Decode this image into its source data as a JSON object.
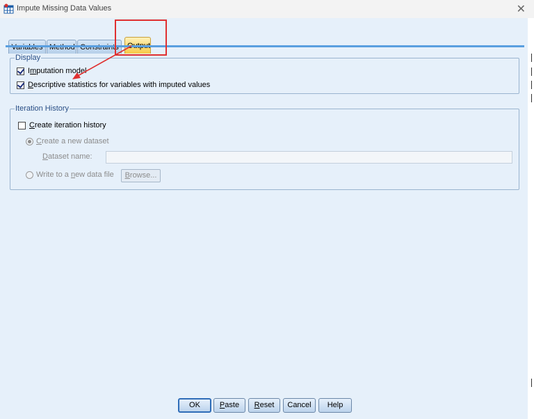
{
  "window": {
    "title": "Impute Missing Data Values",
    "icon": "dataset-table-icon",
    "close_glyph": "✕"
  },
  "tabs": [
    {
      "label": "Variables",
      "active": false
    },
    {
      "label": "Method",
      "active": false
    },
    {
      "label": "Constraints",
      "active": false
    },
    {
      "label": "Output",
      "active": true
    }
  ],
  "display": {
    "legend": "Display",
    "imputation_model": {
      "pre": "I",
      "key": "m",
      "post": "putation model",
      "checked": true
    },
    "descriptive_stats": {
      "pre": "",
      "key": "D",
      "post": "escriptive statistics for variables with imputed values",
      "checked": true
    }
  },
  "iteration": {
    "legend": "Iteration History",
    "create_history": {
      "pre": "",
      "key": "C",
      "post": "reate iteration history",
      "checked": false
    },
    "new_dataset": {
      "pre": "",
      "key": "C",
      "post": "reate a new dataset",
      "selected": true
    },
    "dataset_name": {
      "pre": "",
      "key": "D",
      "post": "ataset name:",
      "value": ""
    },
    "write_file": {
      "pre": "Write to a ",
      "key": "n",
      "post": "ew data file",
      "selected": false
    },
    "browse": {
      "pre": "",
      "key": "B",
      "post": "rowse..."
    }
  },
  "buttons": {
    "ok": "OK",
    "paste": {
      "pre": "",
      "key": "P",
      "post": "aste"
    },
    "reset": {
      "pre": "",
      "key": "R",
      "post": "eset"
    },
    "cancel": "Cancel",
    "help": "Help"
  },
  "colors": {
    "annotation_red": "#e03030",
    "tab_active": "#f7c948",
    "group_legend": "#2a4f86"
  }
}
